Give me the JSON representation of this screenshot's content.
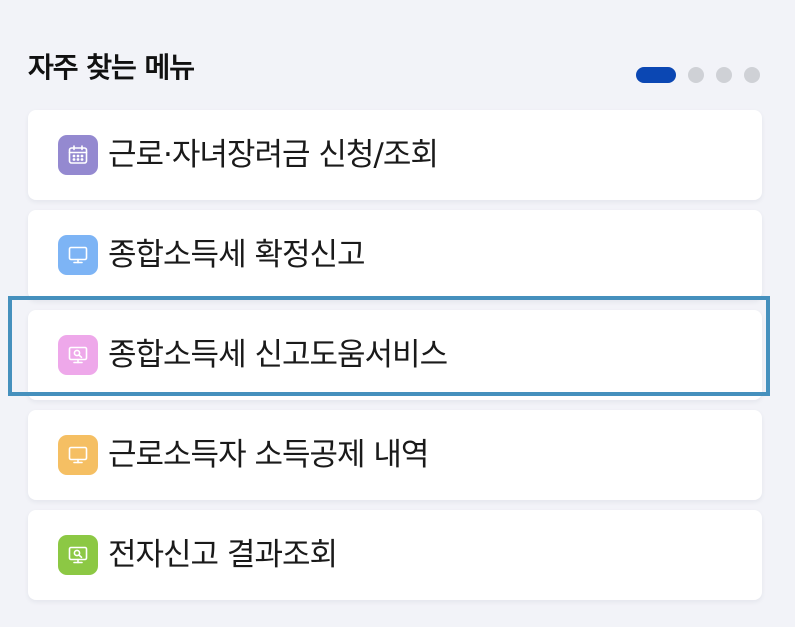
{
  "section": {
    "title": "자주 찾는 메뉴"
  },
  "pager": {
    "page_count": 4,
    "active_index": 0,
    "active_color": "#0b47b3",
    "inactive_color": "#cfd1d6"
  },
  "menu": {
    "items": [
      {
        "label": "근로·자녀장려금 신청/조회",
        "icon": "calendar-icon",
        "color": "#9489d0"
      },
      {
        "label": "종합소득세 확정신고",
        "icon": "monitor-icon",
        "color": "#7db4f5"
      },
      {
        "label": "종합소득세 신고도움서비스",
        "icon": "monitor-search-icon",
        "color": "#eea8ea"
      },
      {
        "label": "근로소득자 소득공제 내역",
        "icon": "monitor-icon",
        "color": "#f5bf63"
      },
      {
        "label": "전자신고 결과조회",
        "icon": "monitor-search-icon",
        "color": "#8cc844"
      }
    ],
    "focused_index": 2,
    "focus_color": "#4590bd"
  }
}
